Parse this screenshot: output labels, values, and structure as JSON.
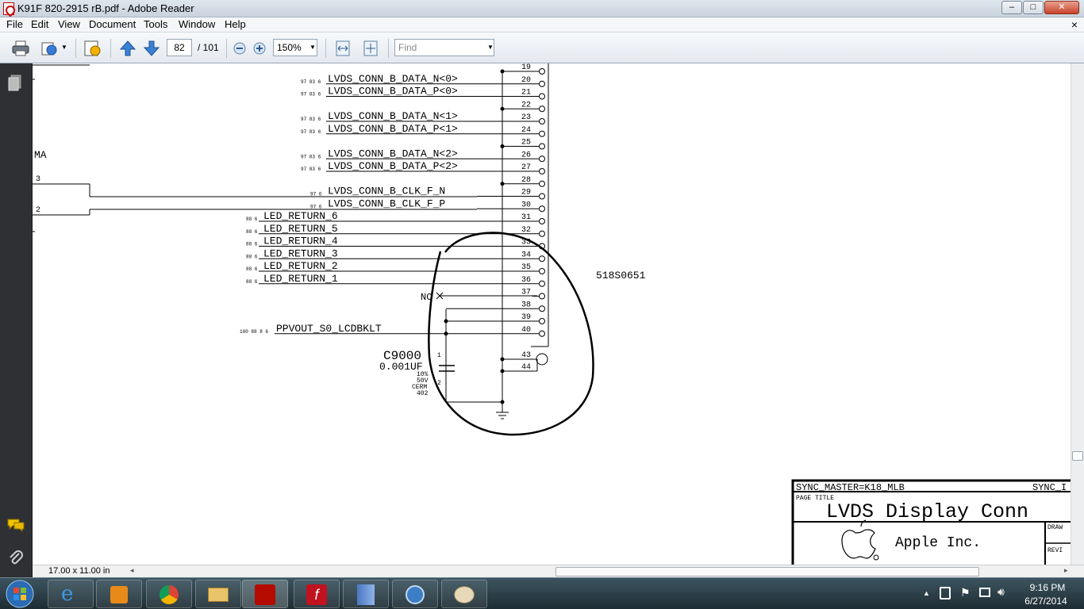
{
  "window": {
    "title": "K91F 820-2915 rB.pdf - Adobe Reader",
    "minimize": "‒",
    "maximize": "□",
    "close": "✕"
  },
  "menu": {
    "items": [
      "File",
      "Edit",
      "View",
      "Document",
      "Tools",
      "Window",
      "Help"
    ],
    "doc_close": "×"
  },
  "toolbar": {
    "page_current": "82",
    "page_total": "/ 101",
    "zoom": "150%",
    "find_placeholder": "Find"
  },
  "schematic": {
    "pins": [
      {
        "num": "19",
        "net": "",
        "refs": ""
      },
      {
        "num": "20",
        "net": "LVDS_CONN_B_DATA_N<0>",
        "refs": "97 83 6"
      },
      {
        "num": "21",
        "net": "LVDS_CONN_B_DATA_P<0>",
        "refs": "97 83 6"
      },
      {
        "num": "22",
        "net": "",
        "refs": ""
      },
      {
        "num": "23",
        "net": "LVDS_CONN_B_DATA_N<1>",
        "refs": "97 83 6"
      },
      {
        "num": "24",
        "net": "LVDS_CONN_B_DATA_P<1>",
        "refs": "97 83 6"
      },
      {
        "num": "25",
        "net": "",
        "refs": ""
      },
      {
        "num": "26",
        "net": "LVDS_CONN_B_DATA_N<2>",
        "refs": "97 83 6"
      },
      {
        "num": "27",
        "net": "LVDS_CONN_B_DATA_P<2>",
        "refs": "97 83 6"
      },
      {
        "num": "28",
        "net": "",
        "refs": ""
      },
      {
        "num": "29",
        "net": "LVDS_CONN_B_CLK_F_N",
        "refs": "97 6"
      },
      {
        "num": "30",
        "net": "LVDS_CONN_B_CLK_F_P",
        "refs": "97 6"
      },
      {
        "num": "31",
        "net": "LED_RETURN_6",
        "refs": "88 6"
      },
      {
        "num": "32",
        "net": "LED_RETURN_5",
        "refs": "88 6"
      },
      {
        "num": "33",
        "net": "LED_RETURN_4",
        "refs": "88 6"
      },
      {
        "num": "34",
        "net": "LED_RETURN_3",
        "refs": "88 6"
      },
      {
        "num": "35",
        "net": "LED_RETURN_2",
        "refs": "88 6"
      },
      {
        "num": "36",
        "net": "LED_RETURN_1",
        "refs": "88 6"
      },
      {
        "num": "37",
        "net": "",
        "refs": ""
      },
      {
        "num": "38",
        "net": "",
        "refs": ""
      },
      {
        "num": "39",
        "net": "",
        "refs": ""
      },
      {
        "num": "40",
        "net": "PPVOUT_S0_LCDBKLT",
        "refs": "100 88 8 6"
      },
      {
        "num": "43",
        "net": "",
        "refs": ""
      },
      {
        "num": "44",
        "net": "",
        "refs": ""
      }
    ],
    "left_label": "MA",
    "left_num_3": "3",
    "left_num_2": "2",
    "nc_label": "NC",
    "part_number": "518S0651",
    "cap": {
      "ref": "C9000",
      "value": "0.001UF",
      "tol": "10%",
      "volt": "50V",
      "type": "CERM",
      "size": "402",
      "pin1": "1",
      "pin2": "2"
    },
    "title_block": {
      "sync_master": "SYNC_MASTER=K18_MLB",
      "sync_right": "SYNC_I",
      "page_title_label": "PAGE TITLE",
      "page_title": "LVDS Display Conn",
      "company": "Apple Inc.",
      "draw": "DRAW",
      "revi": "REVI"
    }
  },
  "status": {
    "page_size": "17.00 x 11.00 in"
  },
  "tray": {
    "time": "9:16 PM",
    "date": "6/27/2014"
  }
}
